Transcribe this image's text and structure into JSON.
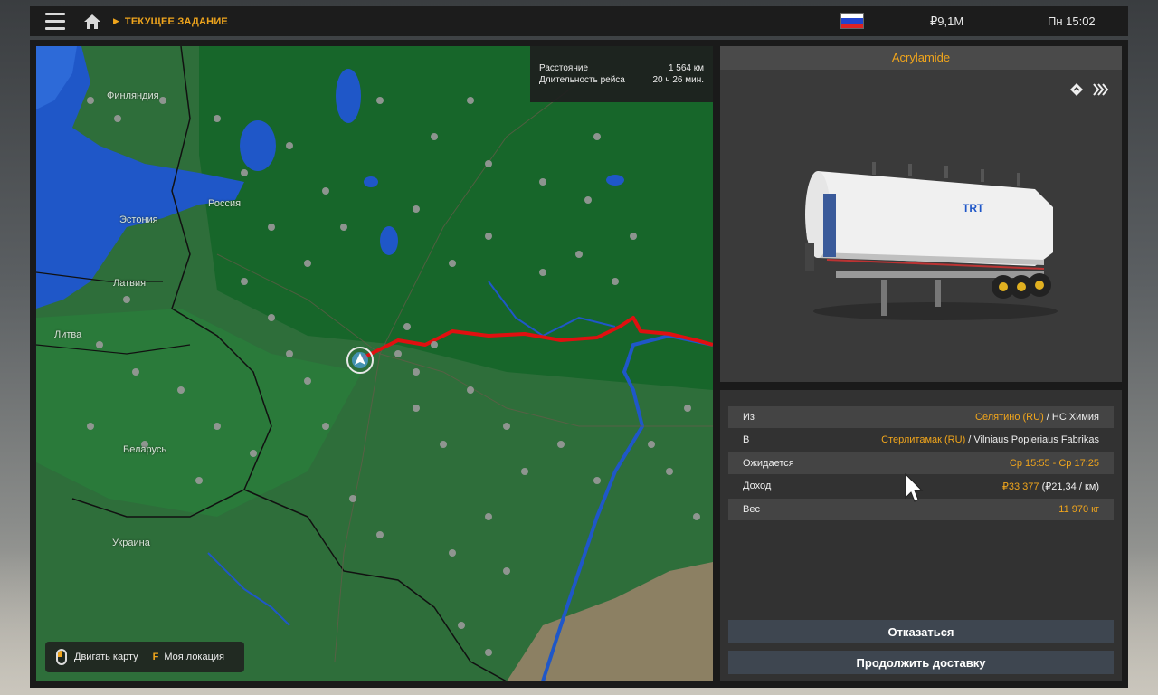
{
  "topbar": {
    "breadcrumb": "ТЕКУЩЕЕ ЗАДАНИЕ",
    "money": "₽9,1M",
    "clock": "Пн 15:02"
  },
  "map": {
    "labels": {
      "finland": "Финляндия",
      "russia": "Россия",
      "estonia": "Эстония",
      "latvia": "Латвия",
      "lithuania": "Литва",
      "belarus": "Беларусь",
      "ukraine": "Украина"
    },
    "stats": {
      "distance_label": "Расстояние",
      "distance_value": "1 564 км",
      "duration_label": "Длительность рейса",
      "duration_value": "20 ч 26 мин."
    },
    "legend": {
      "move_label": "Двигать карту",
      "key": "F",
      "location_label": "Моя локация"
    }
  },
  "cargo": {
    "name": "Acrylamide",
    "trailer_brand": "TRT"
  },
  "details": {
    "from_label": "Из",
    "from_city": "Селятино (RU)",
    "from_company": "НС Химия",
    "to_label": "В",
    "to_city": "Стерлитамак (RU)",
    "to_company": "Vilniaus Popieriaus Fabrikas",
    "expected_label": "Ожидается",
    "expected_value": "Ср 15:55 - Ср 17:25",
    "income_label": "Доход",
    "income_value": "₽33 377",
    "income_per_km": "(₽21,34 / км)",
    "weight_label": "Вес",
    "weight_value": "11 970 кг",
    "slash": " / "
  },
  "actions": {
    "cancel": "Отказаться",
    "continue": "Продолжить доставку"
  },
  "colors": {
    "accent": "#f0a51c",
    "route": "#e01010",
    "water": "#1f57c8",
    "land": "#2e6e3a"
  }
}
